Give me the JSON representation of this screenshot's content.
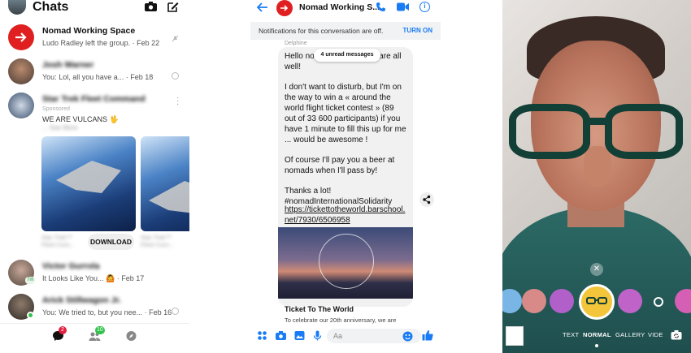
{
  "chats": {
    "title": "Chats",
    "items": [
      {
        "name": "Nomad Working Space",
        "preview": "Ludo Radley left the group. · Feb 22"
      },
      {
        "name": "Josh Warner",
        "preview": "You: Lol, all you have a... · Feb 18"
      },
      {
        "name": "Star Trek Fleet Command",
        "preview": "WE ARE VULCANS 🖖",
        "sponsored": "Sponsored",
        "see_more": "... See More"
      },
      {
        "name": "Victor Gurrola",
        "preview": "It Looks Like You... 🙆 · Feb 17"
      },
      {
        "name": "Arick Stillwagon Jr.",
        "preview": "You: We tried to, but you nee... · Feb 16"
      }
    ],
    "ad": {
      "caption_1": "Star Trek™ Fleet Com...",
      "caption_2": "Star Trek™ Fleet Com...",
      "download_label": "DOWNLOAD"
    },
    "nav": {
      "chats_badge": "2",
      "people_badge": "10"
    },
    "presence_7m": "7m"
  },
  "conversation": {
    "name": "Nomad Working S...",
    "notification": "Notifications for this conversation are off.",
    "turn_on_label": "TURN ON",
    "sender": "Delphine",
    "unread_label": "4 unread messages",
    "paragraphs": [
      "Hello nomads, I hope you are all well!",
      "I don't want to disturb, but I'm on the way to win a « around the world flight ticket contest » (89 out of 33 600 participants) if you have 1 minute to fill this up for me ... would be awesome !",
      "Of course I'll pay you a beer at nomads when I'll pass by!",
      "Thanks a lot!\n#nomadInternationalSolidarity"
    ],
    "link": "https://tickettotheworld.barschool.net/7930/6506958",
    "card_title": "Ticket To The World",
    "card_desc": "To celebrate our 20th anniversary, we are",
    "composer_placeholder": "Aa",
    "accent": "#1a7cf5"
  },
  "camera": {
    "modes": [
      "TEXT",
      "NORMAL",
      "GALLERY",
      "VIDE"
    ],
    "active_mode": "NORMAL"
  }
}
